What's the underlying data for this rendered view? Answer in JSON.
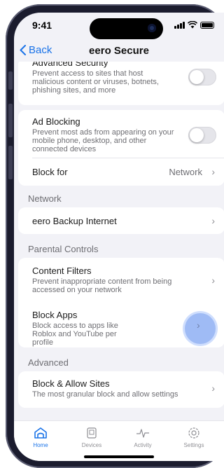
{
  "status_bar": {
    "time": "9:41"
  },
  "nav": {
    "back_label": "Back",
    "title": "eero Secure"
  },
  "security_card": {
    "advanced_security": {
      "title": "Advanced Security",
      "description": "Prevent access to sites that host malicious content or viruses, botnets, phishing sites, and more",
      "enabled": false
    }
  },
  "ad_card": {
    "ad_blocking": {
      "title": "Ad Blocking",
      "description": "Prevent most ads from appearing on your mobile phone, desktop, and other connected devices",
      "enabled": false
    },
    "block_for": {
      "title": "Block for",
      "value": "Network"
    }
  },
  "sections": {
    "network": "Network",
    "parental_controls": "Parental Controls",
    "advanced": "Advanced"
  },
  "network_card": {
    "backup_internet": "eero Backup Internet"
  },
  "parental_card": {
    "content_filters": {
      "title": "Content Filters",
      "description": "Prevent inappropriate content from being accessed on your network"
    },
    "block_apps": {
      "title": "Block Apps",
      "description": "Block access to apps like Roblox and YouTube per profile"
    }
  },
  "advanced_card": {
    "block_allow": {
      "title": "Block & Allow Sites",
      "description": "The most granular block and allow settings"
    }
  },
  "tabbar": {
    "items": [
      {
        "label": "Home",
        "icon": "home-icon",
        "active": true
      },
      {
        "label": "Devices",
        "icon": "devices-icon",
        "active": false
      },
      {
        "label": "Activity",
        "icon": "activity-icon",
        "active": false
      },
      {
        "label": "Settings",
        "icon": "settings-icon",
        "active": false
      }
    ]
  },
  "colors": {
    "accent": "#1a73e8",
    "background": "#f2f2f7",
    "highlight": "#8fb0f4"
  }
}
